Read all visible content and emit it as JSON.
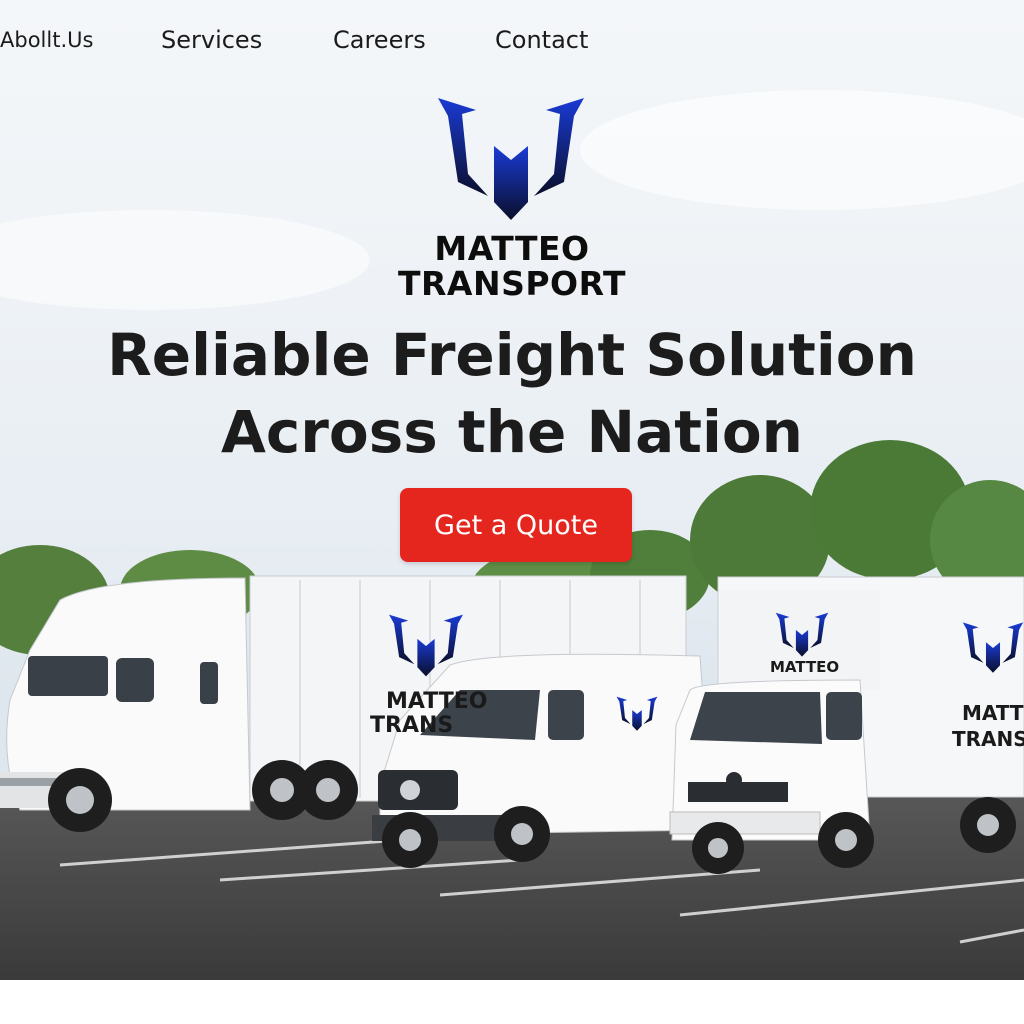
{
  "nav": {
    "items": [
      {
        "label": "Abollt.Us"
      },
      {
        "label": "Services"
      },
      {
        "label": "Careers"
      },
      {
        "label": "Contact"
      }
    ]
  },
  "brand": {
    "line1": "MATTEO",
    "line2": "TRANSPORT",
    "logo_icon": "stylized-m-wings-icon",
    "logo_colors": [
      "#1a3bd6",
      "#0a0f2a"
    ]
  },
  "hero": {
    "headline_line1": "Reliable Freight Solution",
    "headline_line2": "Across the Nation",
    "cta_label": "Get a Quote",
    "cta_color": "#e4261f"
  },
  "vehicles": {
    "semi_trailer_brand": [
      "MATTEO",
      "TRANS"
    ],
    "box_truck_top_brand": "MATTEO",
    "box_truck_side_brand": [
      "MATTEO",
      "TRANSPORT"
    ]
  }
}
